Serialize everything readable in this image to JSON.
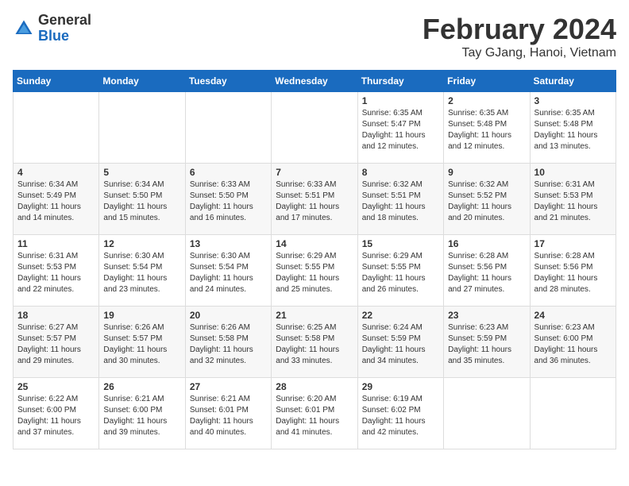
{
  "header": {
    "logo_general": "General",
    "logo_blue": "Blue",
    "month_year": "February 2024",
    "location": "Tay GJang, Hanoi, Vietnam"
  },
  "weekdays": [
    "Sunday",
    "Monday",
    "Tuesday",
    "Wednesday",
    "Thursday",
    "Friday",
    "Saturday"
  ],
  "weeks": [
    [
      {
        "day": "",
        "info": ""
      },
      {
        "day": "",
        "info": ""
      },
      {
        "day": "",
        "info": ""
      },
      {
        "day": "",
        "info": ""
      },
      {
        "day": "1",
        "info": "Sunrise: 6:35 AM\nSunset: 5:47 PM\nDaylight: 11 hours\nand 12 minutes."
      },
      {
        "day": "2",
        "info": "Sunrise: 6:35 AM\nSunset: 5:48 PM\nDaylight: 11 hours\nand 12 minutes."
      },
      {
        "day": "3",
        "info": "Sunrise: 6:35 AM\nSunset: 5:48 PM\nDaylight: 11 hours\nand 13 minutes."
      }
    ],
    [
      {
        "day": "4",
        "info": "Sunrise: 6:34 AM\nSunset: 5:49 PM\nDaylight: 11 hours\nand 14 minutes."
      },
      {
        "day": "5",
        "info": "Sunrise: 6:34 AM\nSunset: 5:50 PM\nDaylight: 11 hours\nand 15 minutes."
      },
      {
        "day": "6",
        "info": "Sunrise: 6:33 AM\nSunset: 5:50 PM\nDaylight: 11 hours\nand 16 minutes."
      },
      {
        "day": "7",
        "info": "Sunrise: 6:33 AM\nSunset: 5:51 PM\nDaylight: 11 hours\nand 17 minutes."
      },
      {
        "day": "8",
        "info": "Sunrise: 6:32 AM\nSunset: 5:51 PM\nDaylight: 11 hours\nand 18 minutes."
      },
      {
        "day": "9",
        "info": "Sunrise: 6:32 AM\nSunset: 5:52 PM\nDaylight: 11 hours\nand 20 minutes."
      },
      {
        "day": "10",
        "info": "Sunrise: 6:31 AM\nSunset: 5:53 PM\nDaylight: 11 hours\nand 21 minutes."
      }
    ],
    [
      {
        "day": "11",
        "info": "Sunrise: 6:31 AM\nSunset: 5:53 PM\nDaylight: 11 hours\nand 22 minutes."
      },
      {
        "day": "12",
        "info": "Sunrise: 6:30 AM\nSunset: 5:54 PM\nDaylight: 11 hours\nand 23 minutes."
      },
      {
        "day": "13",
        "info": "Sunrise: 6:30 AM\nSunset: 5:54 PM\nDaylight: 11 hours\nand 24 minutes."
      },
      {
        "day": "14",
        "info": "Sunrise: 6:29 AM\nSunset: 5:55 PM\nDaylight: 11 hours\nand 25 minutes."
      },
      {
        "day": "15",
        "info": "Sunrise: 6:29 AM\nSunset: 5:55 PM\nDaylight: 11 hours\nand 26 minutes."
      },
      {
        "day": "16",
        "info": "Sunrise: 6:28 AM\nSunset: 5:56 PM\nDaylight: 11 hours\nand 27 minutes."
      },
      {
        "day": "17",
        "info": "Sunrise: 6:28 AM\nSunset: 5:56 PM\nDaylight: 11 hours\nand 28 minutes."
      }
    ],
    [
      {
        "day": "18",
        "info": "Sunrise: 6:27 AM\nSunset: 5:57 PM\nDaylight: 11 hours\nand 29 minutes."
      },
      {
        "day": "19",
        "info": "Sunrise: 6:26 AM\nSunset: 5:57 PM\nDaylight: 11 hours\nand 30 minutes."
      },
      {
        "day": "20",
        "info": "Sunrise: 6:26 AM\nSunset: 5:58 PM\nDaylight: 11 hours\nand 32 minutes."
      },
      {
        "day": "21",
        "info": "Sunrise: 6:25 AM\nSunset: 5:58 PM\nDaylight: 11 hours\nand 33 minutes."
      },
      {
        "day": "22",
        "info": "Sunrise: 6:24 AM\nSunset: 5:59 PM\nDaylight: 11 hours\nand 34 minutes."
      },
      {
        "day": "23",
        "info": "Sunrise: 6:23 AM\nSunset: 5:59 PM\nDaylight: 11 hours\nand 35 minutes."
      },
      {
        "day": "24",
        "info": "Sunrise: 6:23 AM\nSunset: 6:00 PM\nDaylight: 11 hours\nand 36 minutes."
      }
    ],
    [
      {
        "day": "25",
        "info": "Sunrise: 6:22 AM\nSunset: 6:00 PM\nDaylight: 11 hours\nand 37 minutes."
      },
      {
        "day": "26",
        "info": "Sunrise: 6:21 AM\nSunset: 6:00 PM\nDaylight: 11 hours\nand 39 minutes."
      },
      {
        "day": "27",
        "info": "Sunrise: 6:21 AM\nSunset: 6:01 PM\nDaylight: 11 hours\nand 40 minutes."
      },
      {
        "day": "28",
        "info": "Sunrise: 6:20 AM\nSunset: 6:01 PM\nDaylight: 11 hours\nand 41 minutes."
      },
      {
        "day": "29",
        "info": "Sunrise: 6:19 AM\nSunset: 6:02 PM\nDaylight: 11 hours\nand 42 minutes."
      },
      {
        "day": "",
        "info": ""
      },
      {
        "day": "",
        "info": ""
      }
    ]
  ]
}
